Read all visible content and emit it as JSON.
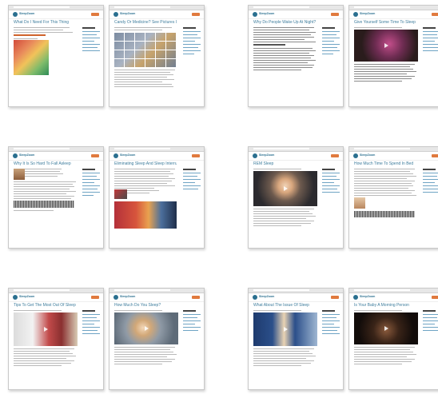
{
  "thumbnails": [
    {
      "title": "What Do I Need For This Thing",
      "logo": "SleepZoom",
      "image": "chart"
    },
    {
      "title": "Candy Or Medicine? See Pictures Inside",
      "logo": "SleepZoom",
      "image": "grid"
    },
    {
      "title": "Why Do People Wake Up At Night?",
      "logo": "SleepZoom",
      "image": "none"
    },
    {
      "title": "Give Yourself Some Time To Sleep",
      "logo": "SleepZoom",
      "image": "video"
    },
    {
      "title": "Why It Is So Hard To Fall Asleep",
      "logo": "SleepZoom",
      "image": "portrait"
    },
    {
      "title": "Eliminating Sleep And Sleep Interruptions",
      "logo": "SleepZoom",
      "image": "collage"
    },
    {
      "title": "REM Sleep",
      "logo": "SleepZoom",
      "image": "video-face"
    },
    {
      "title": "How Much Time To Spend In Bed",
      "logo": "SleepZoom",
      "image": "portrait-late"
    },
    {
      "title": "Tips To Get The Most Out Of Sleep",
      "logo": "SleepZoom",
      "image": "video-room"
    },
    {
      "title": "How Much Do You Sleep?",
      "logo": "SleepZoom",
      "image": "video-wide"
    },
    {
      "title": "What About The Issue Of Sleep",
      "logo": "SleepZoom",
      "image": "video-stage"
    },
    {
      "title": "Is Your Baby A Morning Person",
      "logo": "SleepZoom",
      "image": "video-dark"
    }
  ]
}
